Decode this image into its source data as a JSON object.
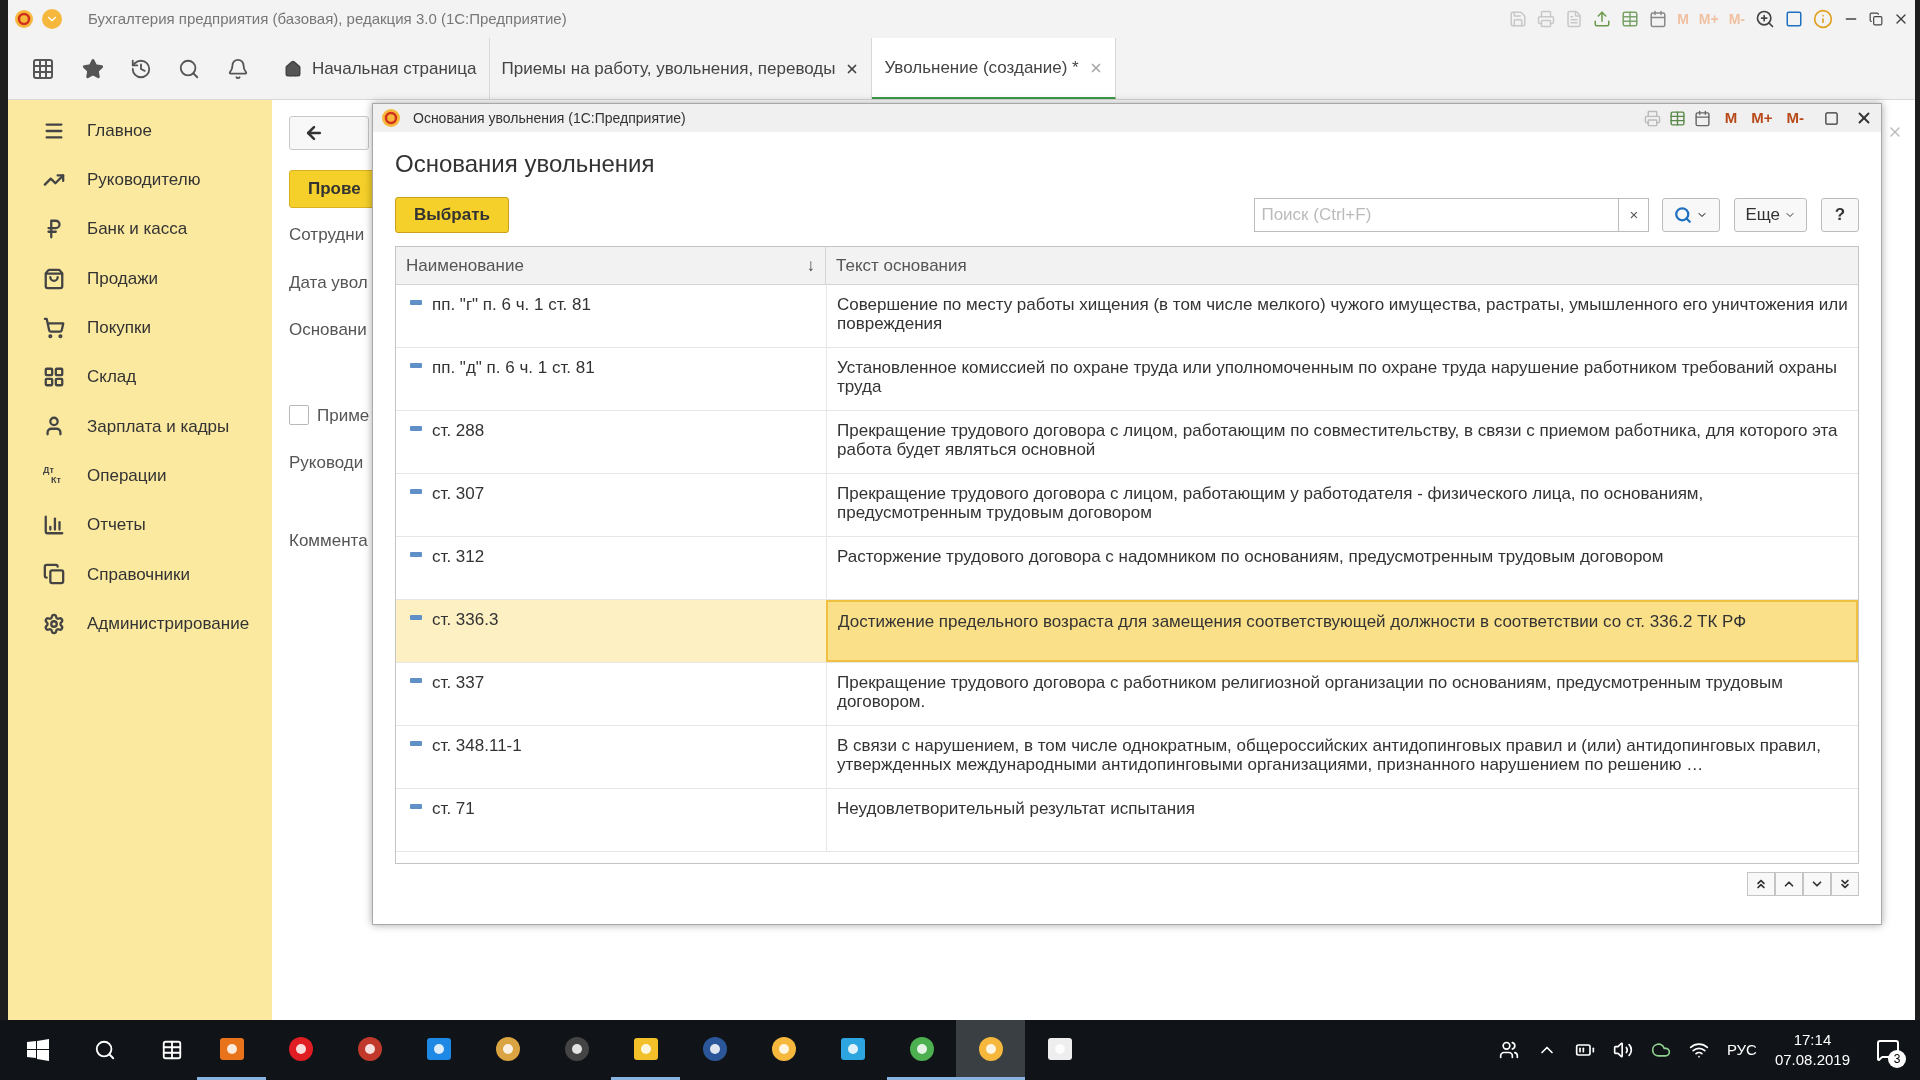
{
  "window": {
    "title": "Бухгалтерия предприятия (базовая), редакция 3.0  (1С:Предприятие)",
    "memory_buttons": [
      "M",
      "M+",
      "M-"
    ]
  },
  "tabs": [
    {
      "label": "Начальная страница",
      "kind": "home",
      "selected": false
    },
    {
      "label": "Приемы на работу, увольнения, переводы",
      "kind": "document",
      "selected": false
    },
    {
      "label": "Увольнение (создание) *",
      "kind": "document",
      "selected": true
    }
  ],
  "sidebar": {
    "items": [
      {
        "label": "Главное"
      },
      {
        "label": "Руководителю"
      },
      {
        "label": "Банк и касса"
      },
      {
        "label": "Продажи"
      },
      {
        "label": "Покупки"
      },
      {
        "label": "Склад"
      },
      {
        "label": "Зарплата и кадры"
      },
      {
        "label": "Операции",
        "icon_text": [
          "Дт",
          "Кт"
        ]
      },
      {
        "label": "Отчеты"
      },
      {
        "label": "Справочники"
      },
      {
        "label": "Администрирование"
      }
    ]
  },
  "form": {
    "post_button": "Прове",
    "fields": [
      {
        "label": "Сотрудни",
        "kind": "text"
      },
      {
        "label": "Дата увол",
        "kind": "text"
      },
      {
        "label": "Основани",
        "kind": "text"
      },
      {
        "label": "Приме",
        "kind": "checkbox",
        "checked": false
      },
      {
        "label": "Руководи",
        "kind": "text"
      },
      {
        "label": "Коммента",
        "kind": "text"
      }
    ]
  },
  "dialog": {
    "title": "Основания увольнения  (1С:Предприятие)",
    "memory_buttons": [
      "M",
      "M+",
      "M-"
    ],
    "heading": "Основания увольнения",
    "select_button": "Выбрать",
    "search": {
      "placeholder": "Поиск (Ctrl+F)"
    },
    "clear_button": "×",
    "more_button": "Еще",
    "help_button": "?",
    "columns": [
      {
        "label": "Наименование",
        "sort": "↓"
      },
      {
        "label": "Текст основания"
      }
    ],
    "rows": [
      {
        "name": "пп. \"г\" п. 6 ч. 1 ст. 81",
        "text": "Совершение по месту работы хищения (в том числе мелкого) чужого имущества, растраты, умышленного его уничтожения или повреждения",
        "selected": false
      },
      {
        "name": "пп. \"д\" п. 6 ч. 1 ст. 81",
        "text": "Установленное комиссией по охране труда или уполномоченным по охране труда нарушение работником требований охраны труда",
        "selected": false
      },
      {
        "name": "ст. 288",
        "text": "Прекращение трудового договора с лицом, работающим по совместительству, в связи с приемом работника, для которого эта работа будет являться основной",
        "selected": false
      },
      {
        "name": "ст. 307",
        "text": "Прекращение трудового договора с лицом, работающим у работодателя - физического лица, по основаниям, предусмотренным трудовым договором",
        "selected": false
      },
      {
        "name": "ст. 312",
        "text": "Расторжение трудового договора с надомником по основаниям, предусмотренным трудовым договором",
        "selected": false
      },
      {
        "name": "ст. 336.3",
        "text": "Достижение предельного возраста для замещения соответствующей должности в соответствии со ст. 336.2 ТК РФ",
        "selected": true
      },
      {
        "name": "ст. 337",
        "text": "Прекращение трудового договора с работником религиозной организации по основаниям, предусмотренным трудовым договором.",
        "selected": false
      },
      {
        "name": "ст. 348.11-1",
        "text": "В связи с нарушением, в том числе однократным, общероссийских антидопинговых правил и (или) антидопинговых правил, утвержденных международными антидопинговыми организациями, признанного нарушением по решению …",
        "selected": false
      },
      {
        "name": "ст. 71",
        "text": "Неудовлетворительный результат испытания",
        "selected": false
      }
    ]
  },
  "taskbar": {
    "apps": [
      {
        "running": true,
        "selected": false
      },
      {
        "running": false,
        "selected": false
      },
      {
        "running": false,
        "selected": false
      },
      {
        "running": false,
        "selected": false
      },
      {
        "running": false,
        "selected": false
      },
      {
        "running": false,
        "selected": false
      },
      {
        "running": true,
        "selected": false
      },
      {
        "running": false,
        "selected": false
      },
      {
        "running": false,
        "selected": false
      },
      {
        "running": false,
        "selected": false
      },
      {
        "running": true,
        "selected": false
      },
      {
        "running": true,
        "selected": true
      },
      {
        "running": false,
        "selected": false
      }
    ],
    "language": "РУС",
    "time": "17:14",
    "date": "07.08.2019",
    "notifications": "3"
  }
}
